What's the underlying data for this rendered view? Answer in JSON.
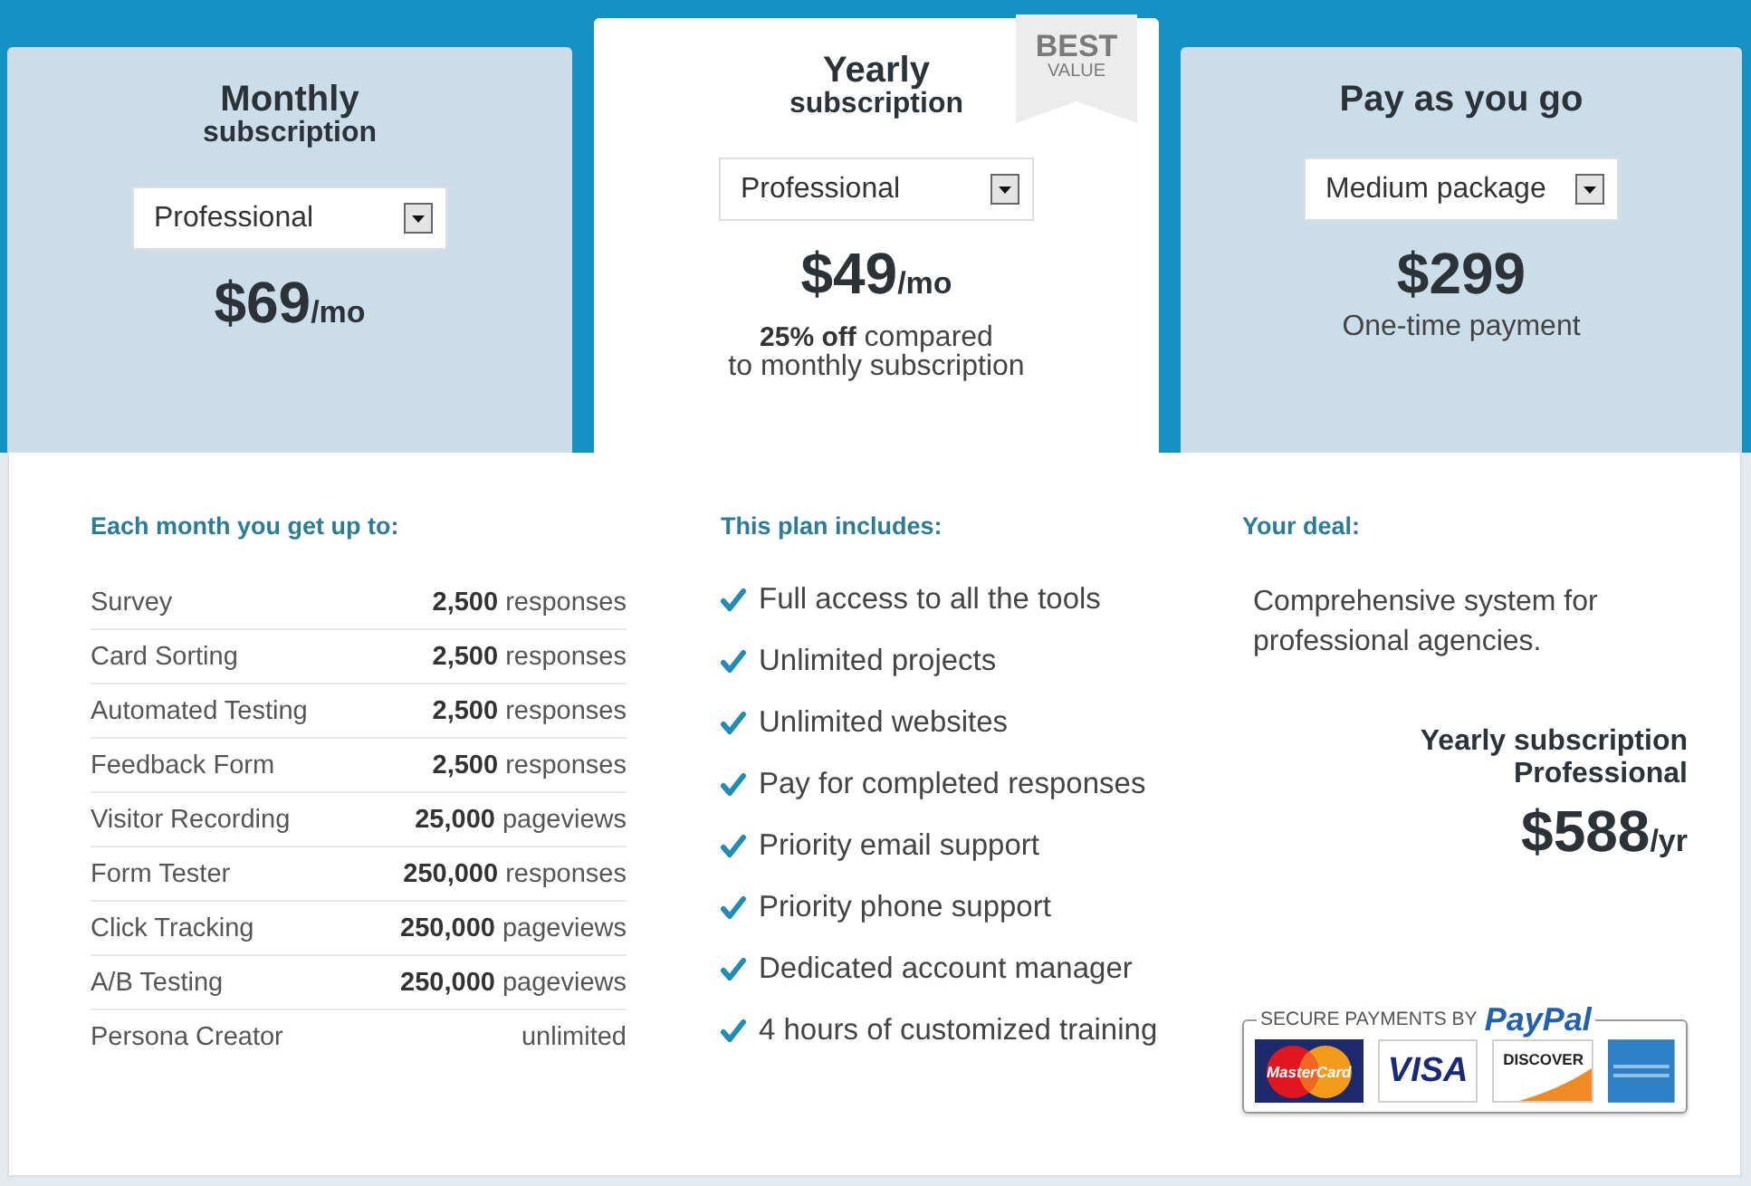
{
  "plans": [
    {
      "title": "Monthly",
      "subtitle": "subscription",
      "selected": false,
      "option": "Professional",
      "price": "$69",
      "unit": "/mo"
    },
    {
      "title": "Yearly",
      "subtitle": "subscription",
      "selected": true,
      "badge": {
        "line_1": "BEST",
        "line_2": "VALUE"
      },
      "option": "Professional",
      "price": "$49",
      "unit": "/mo",
      "notes": [
        "**25% off** compared",
        "to monthly subscription"
      ]
    },
    {
      "title": "Pay as you go",
      "selected": false,
      "option": "Medium package",
      "price": "$299",
      "notes": [
        "One-time payment"
      ]
    }
  ],
  "limits": {
    "heading": "Each month you get up to:",
    "rows": [
      {
        "tool": "Survey",
        "limit": "**2,500** responses"
      },
      {
        "tool": "Card Sorting",
        "limit": "**2,500** responses"
      },
      {
        "tool": "Automated Testing",
        "limit": "**2,500** responses"
      },
      {
        "tool": "Feedback Form",
        "limit": "**2,500** responses"
      },
      {
        "tool": "Visitor Recording",
        "limit": "**25,000** pageviews"
      },
      {
        "tool": "Form Tester",
        "limit": "**250,000** responses"
      },
      {
        "tool": "Click Tracking",
        "limit": "**250,000** pageviews"
      },
      {
        "tool": "A/B Testing",
        "limit": "**250,000** pageviews"
      },
      {
        "tool": "Persona Creator",
        "limit": "unlimited"
      }
    ]
  },
  "features": {
    "heading": "This plan includes:",
    "items": [
      "Full access to all the tools",
      "Unlimited projects",
      "Unlimited websites",
      "Pay for completed responses",
      "Priority email support",
      "Priority phone support",
      "Dedicated account manager",
      "4 hours of customized training"
    ]
  },
  "deal": {
    "heading": "Your deal:",
    "description": "Comprehensive system for professional agencies.",
    "summary": [
      "Yearly subscription",
      "Professional"
    ],
    "price": "$588",
    "unit": "/yr"
  },
  "payments": {
    "label": "SECURE PAYMENTS BY",
    "brand": "PayPal",
    "cards": [
      {
        "kind": "mastercard",
        "text": "MasterCard"
      },
      {
        "kind": "visa",
        "text": "VISA"
      },
      {
        "kind": "discover",
        "text": "DISCOVER"
      },
      {
        "kind": "amex"
      }
    ]
  }
}
